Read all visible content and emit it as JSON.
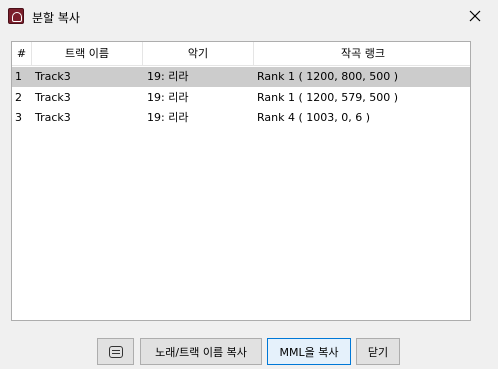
{
  "window": {
    "title": "분할 복사",
    "close_glyph": "✕"
  },
  "table": {
    "headers": [
      "#",
      "트랙 이름",
      "악기",
      "작곡 랭크"
    ],
    "rows": [
      {
        "num": "1",
        "track": "Track3",
        "instrument": "19: 리라",
        "rank": "Rank 1 ( 1200, 800, 500 )",
        "selected": true
      },
      {
        "num": "2",
        "track": "Track3",
        "instrument": "19: 리라",
        "rank": "Rank 1 ( 1200, 579, 500 )",
        "selected": false
      },
      {
        "num": "3",
        "track": "Track3",
        "instrument": "19: 리라",
        "rank": "Rank 4 ( 1003, 0, 6 )",
        "selected": false
      }
    ]
  },
  "buttons": {
    "list_icon": "list-icon",
    "copy_title": "노래/트랙 이름 복사",
    "copy_mml": "MML을 복사",
    "close": "닫기"
  },
  "colors": {
    "selected_row": "#cccccc",
    "accent": "#0078d7",
    "app_icon": "#7a1f2b"
  }
}
